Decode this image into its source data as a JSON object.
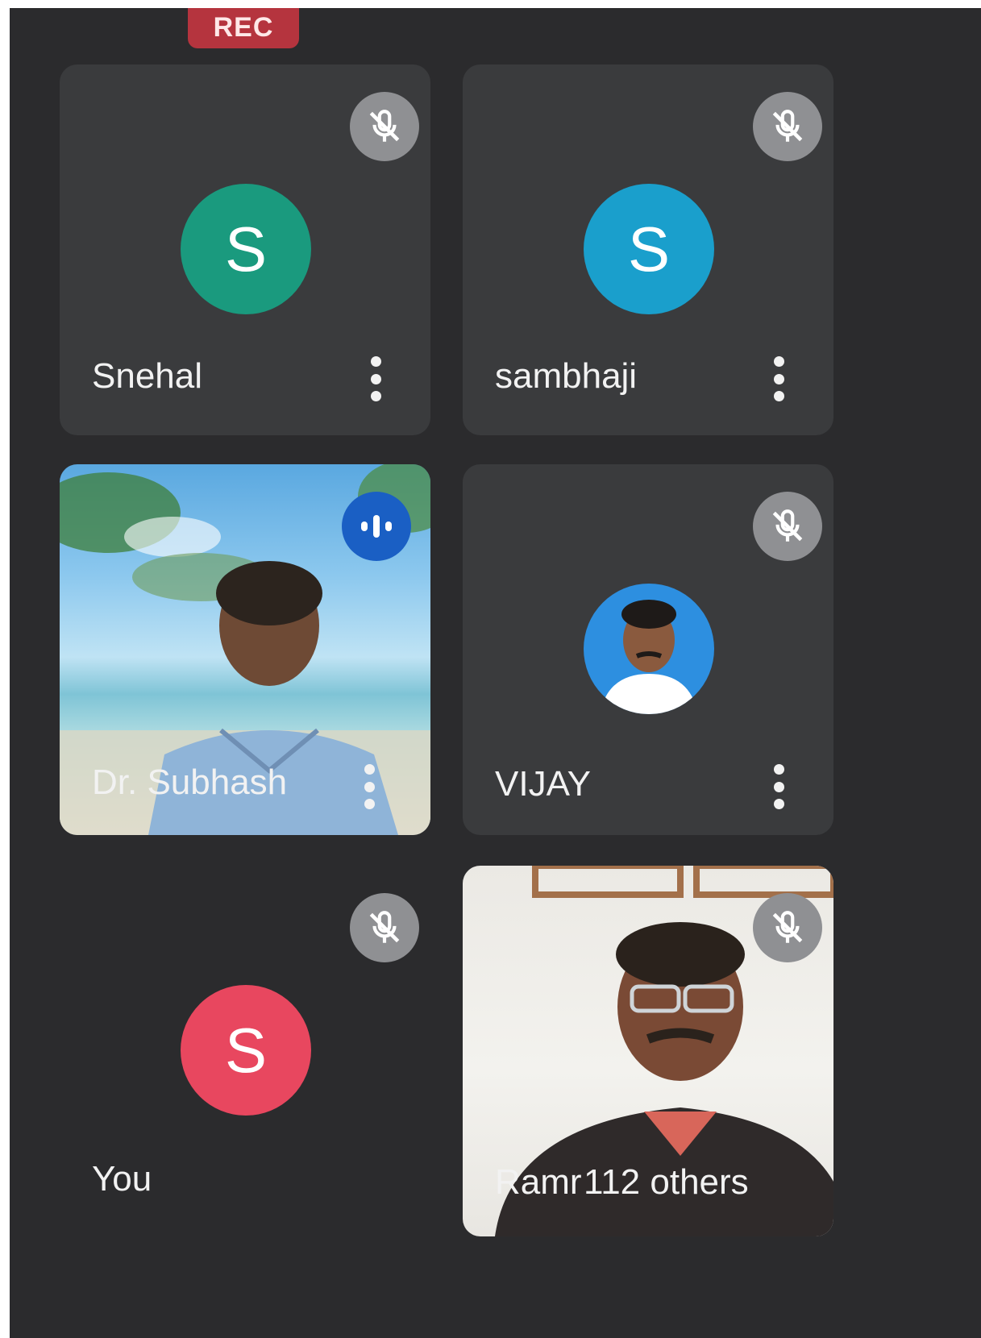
{
  "recording": {
    "label": "REC"
  },
  "participants": [
    {
      "name": "Snehal",
      "initial": "S",
      "avatar_color": "#1a9a7e",
      "state": "muted"
    },
    {
      "name": "sambhaji",
      "initial": "S",
      "avatar_color": "#1a9fcc",
      "state": "muted"
    },
    {
      "name": "Dr. Subhash",
      "state": "speaking"
    },
    {
      "name": "VIJAY",
      "state": "muted"
    },
    {
      "name": "You",
      "initial": "S",
      "avatar_color": "#e8475f",
      "state": "muted"
    },
    {
      "name": "Ramr",
      "state": "muted"
    }
  ],
  "others_label": "112 others",
  "icons": {
    "muted": "mic-off-icon",
    "speaking": "audio-level-icon",
    "more": "more-vert-icon"
  },
  "colors": {
    "background": "#2b2b2d",
    "rec": "#b5343e",
    "speaking": "#1a5fc4",
    "mute_badge": "#8f9093"
  }
}
